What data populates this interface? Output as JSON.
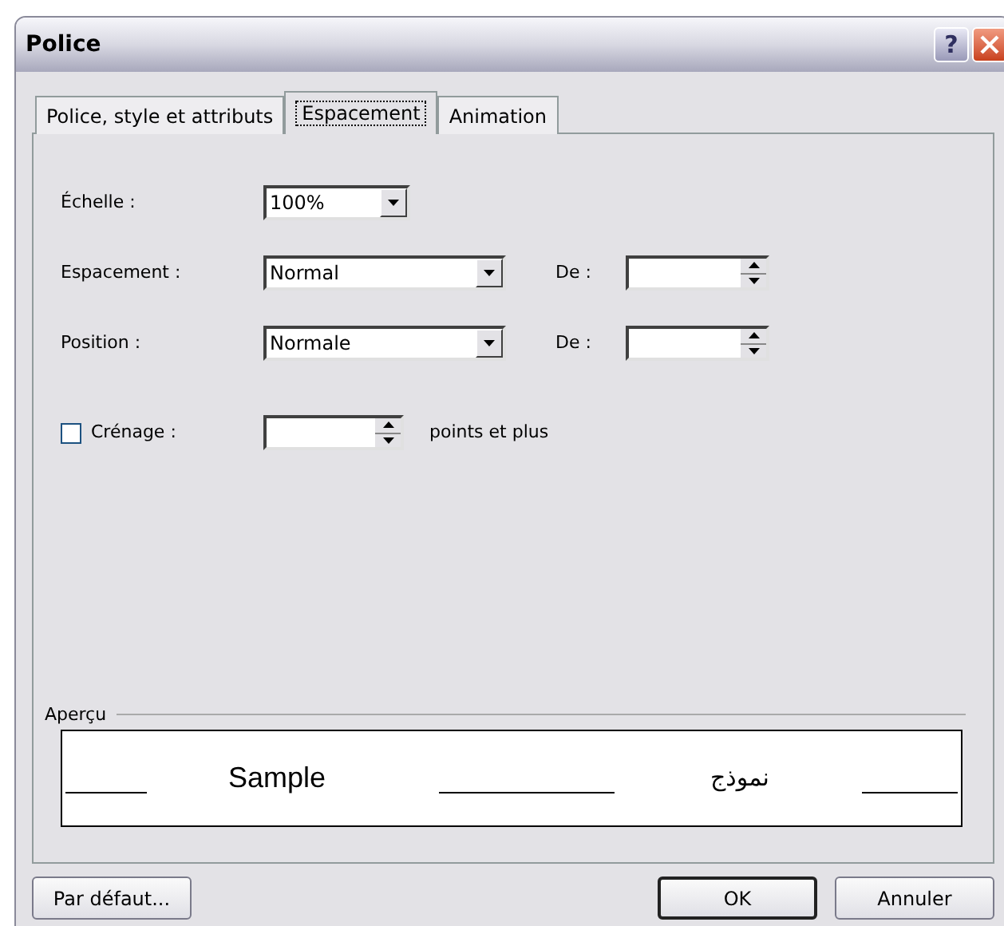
{
  "window": {
    "title": "Police",
    "help_button": "?"
  },
  "tabs": [
    {
      "label": "Police, style et attributs",
      "selected": false
    },
    {
      "label": "Espacement",
      "selected": true
    },
    {
      "label": "Animation",
      "selected": false
    }
  ],
  "scale": {
    "label": "Échelle :",
    "value": "100%"
  },
  "rows": [
    {
      "label": "Espacement :",
      "value": "Normal",
      "by_label": "De :"
    },
    {
      "label": "Position :",
      "value": "Normale",
      "by_label": "De :"
    }
  ],
  "kerning": {
    "label": "Crénage :",
    "checked": false,
    "suffix": "points et plus"
  },
  "preview": {
    "label": "Aperçu",
    "sample": "Sample",
    "sample_rtl": "نموذج"
  },
  "buttons": [
    {
      "label": "Par défaut...",
      "kind": "left",
      "default": false
    },
    {
      "label": "OK",
      "kind": "right",
      "default": true
    },
    {
      "label": "Annuler",
      "kind": "right",
      "default": false
    }
  ]
}
